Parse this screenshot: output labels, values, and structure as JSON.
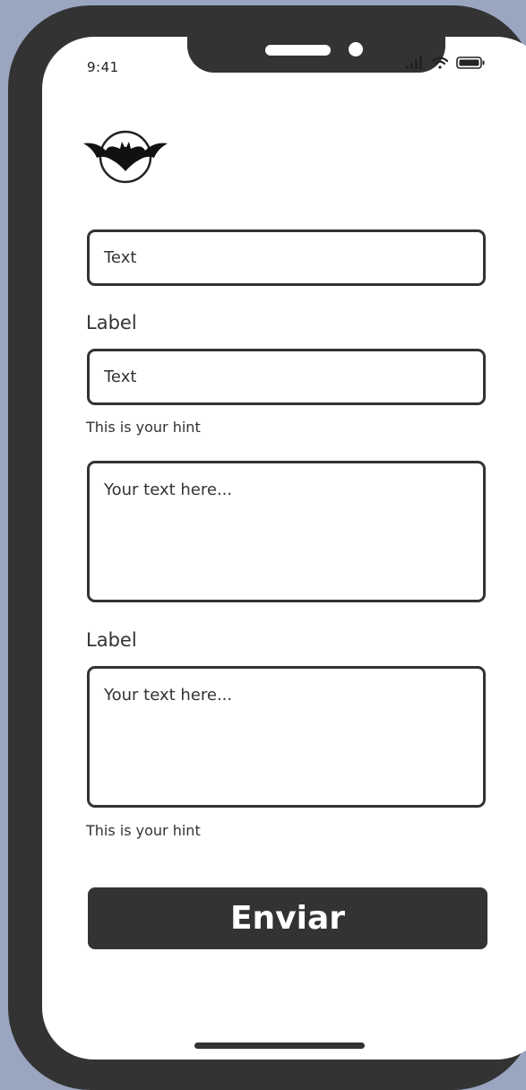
{
  "status_bar": {
    "time": "9:41",
    "icons": [
      "cellular-signal-icon",
      "wifi-icon",
      "battery-icon"
    ]
  },
  "logo": {
    "icon": "bat-logo-icon"
  },
  "form": {
    "field1": {
      "value": "Text"
    },
    "field2": {
      "label": "Label",
      "value": "Text",
      "hint": "This is your hint"
    },
    "area1": {
      "placeholder": "Your text here..."
    },
    "area2": {
      "label": "Label",
      "placeholder": "Your text here...",
      "hint": "This is your hint"
    },
    "submit_label": "Enviar"
  },
  "colors": {
    "background": "#9aa6c0",
    "device": "#333333",
    "screen": "#ffffff",
    "accent": "#333333"
  }
}
